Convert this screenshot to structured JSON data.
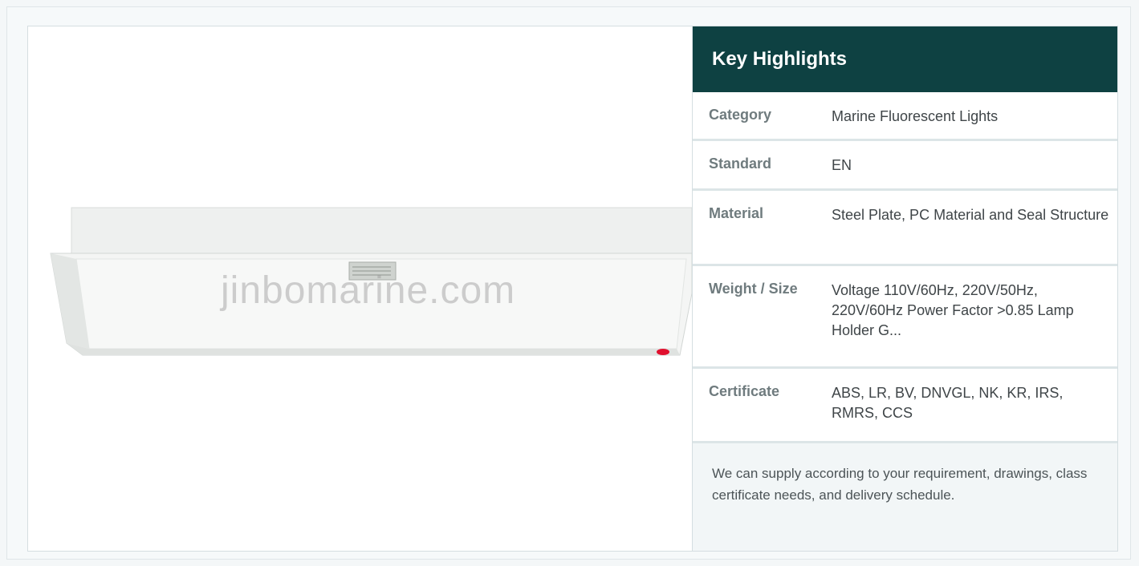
{
  "product_image": {
    "watermark": "jinbomarine.com",
    "label_plate": "",
    "indicator_color": "#e0102e"
  },
  "highlights": {
    "title": "Key Highlights",
    "rows": [
      {
        "label": "Category",
        "value": "Marine Fluorescent Lights"
      },
      {
        "label": "Standard",
        "value": "EN"
      },
      {
        "label": "Material",
        "value": "Steel Plate, PC Material and Seal Structure"
      },
      {
        "label": "Weight / Size",
        "value": "Voltage 110V/60Hz, 220V/50Hz, 220V/60Hz Power Factor >0.85 Lamp Holder G..."
      },
      {
        "label": "Certificate",
        "value": "ABS, LR, BV, DNVGL, NK, KR, IRS, RMRS, CCS"
      }
    ],
    "note": "We can supply according to your requirement, drawings, class certificate needs, and delivery schedule."
  },
  "colors": {
    "header_bg": "#0e4142",
    "header_text": "#ffffff",
    "note_bg": "#f2f6f7"
  }
}
